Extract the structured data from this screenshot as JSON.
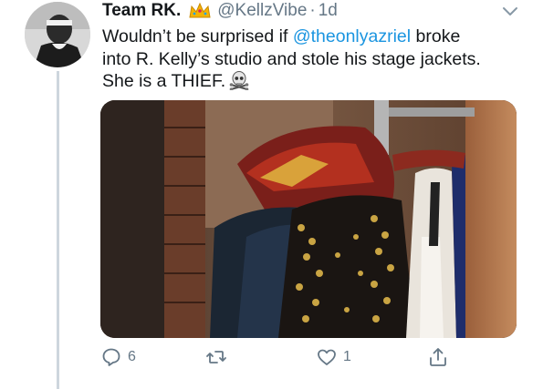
{
  "tweet": {
    "display_name": "Team RK.",
    "handle": "@KellzVibe",
    "separator": "·",
    "time": "1d",
    "text_lines": [
      {
        "before": "Wouldn’t be surprised if ",
        "mention": "@theonlyazriel",
        "after": " broke"
      },
      {
        "text": "into R. Kelly’s studio and stole his stage jackets."
      },
      {
        "text": "She is a THIEF."
      }
    ],
    "badge_icon": "crown-icon",
    "text_icon": "skull-crossbones-icon"
  },
  "actions": {
    "reply_count": "6",
    "retweet_count": "",
    "like_count": "1"
  },
  "colors": {
    "link": "#1b95e0",
    "muted": "#657786",
    "text": "#14171a",
    "thread_line": "#cdd6dd"
  }
}
